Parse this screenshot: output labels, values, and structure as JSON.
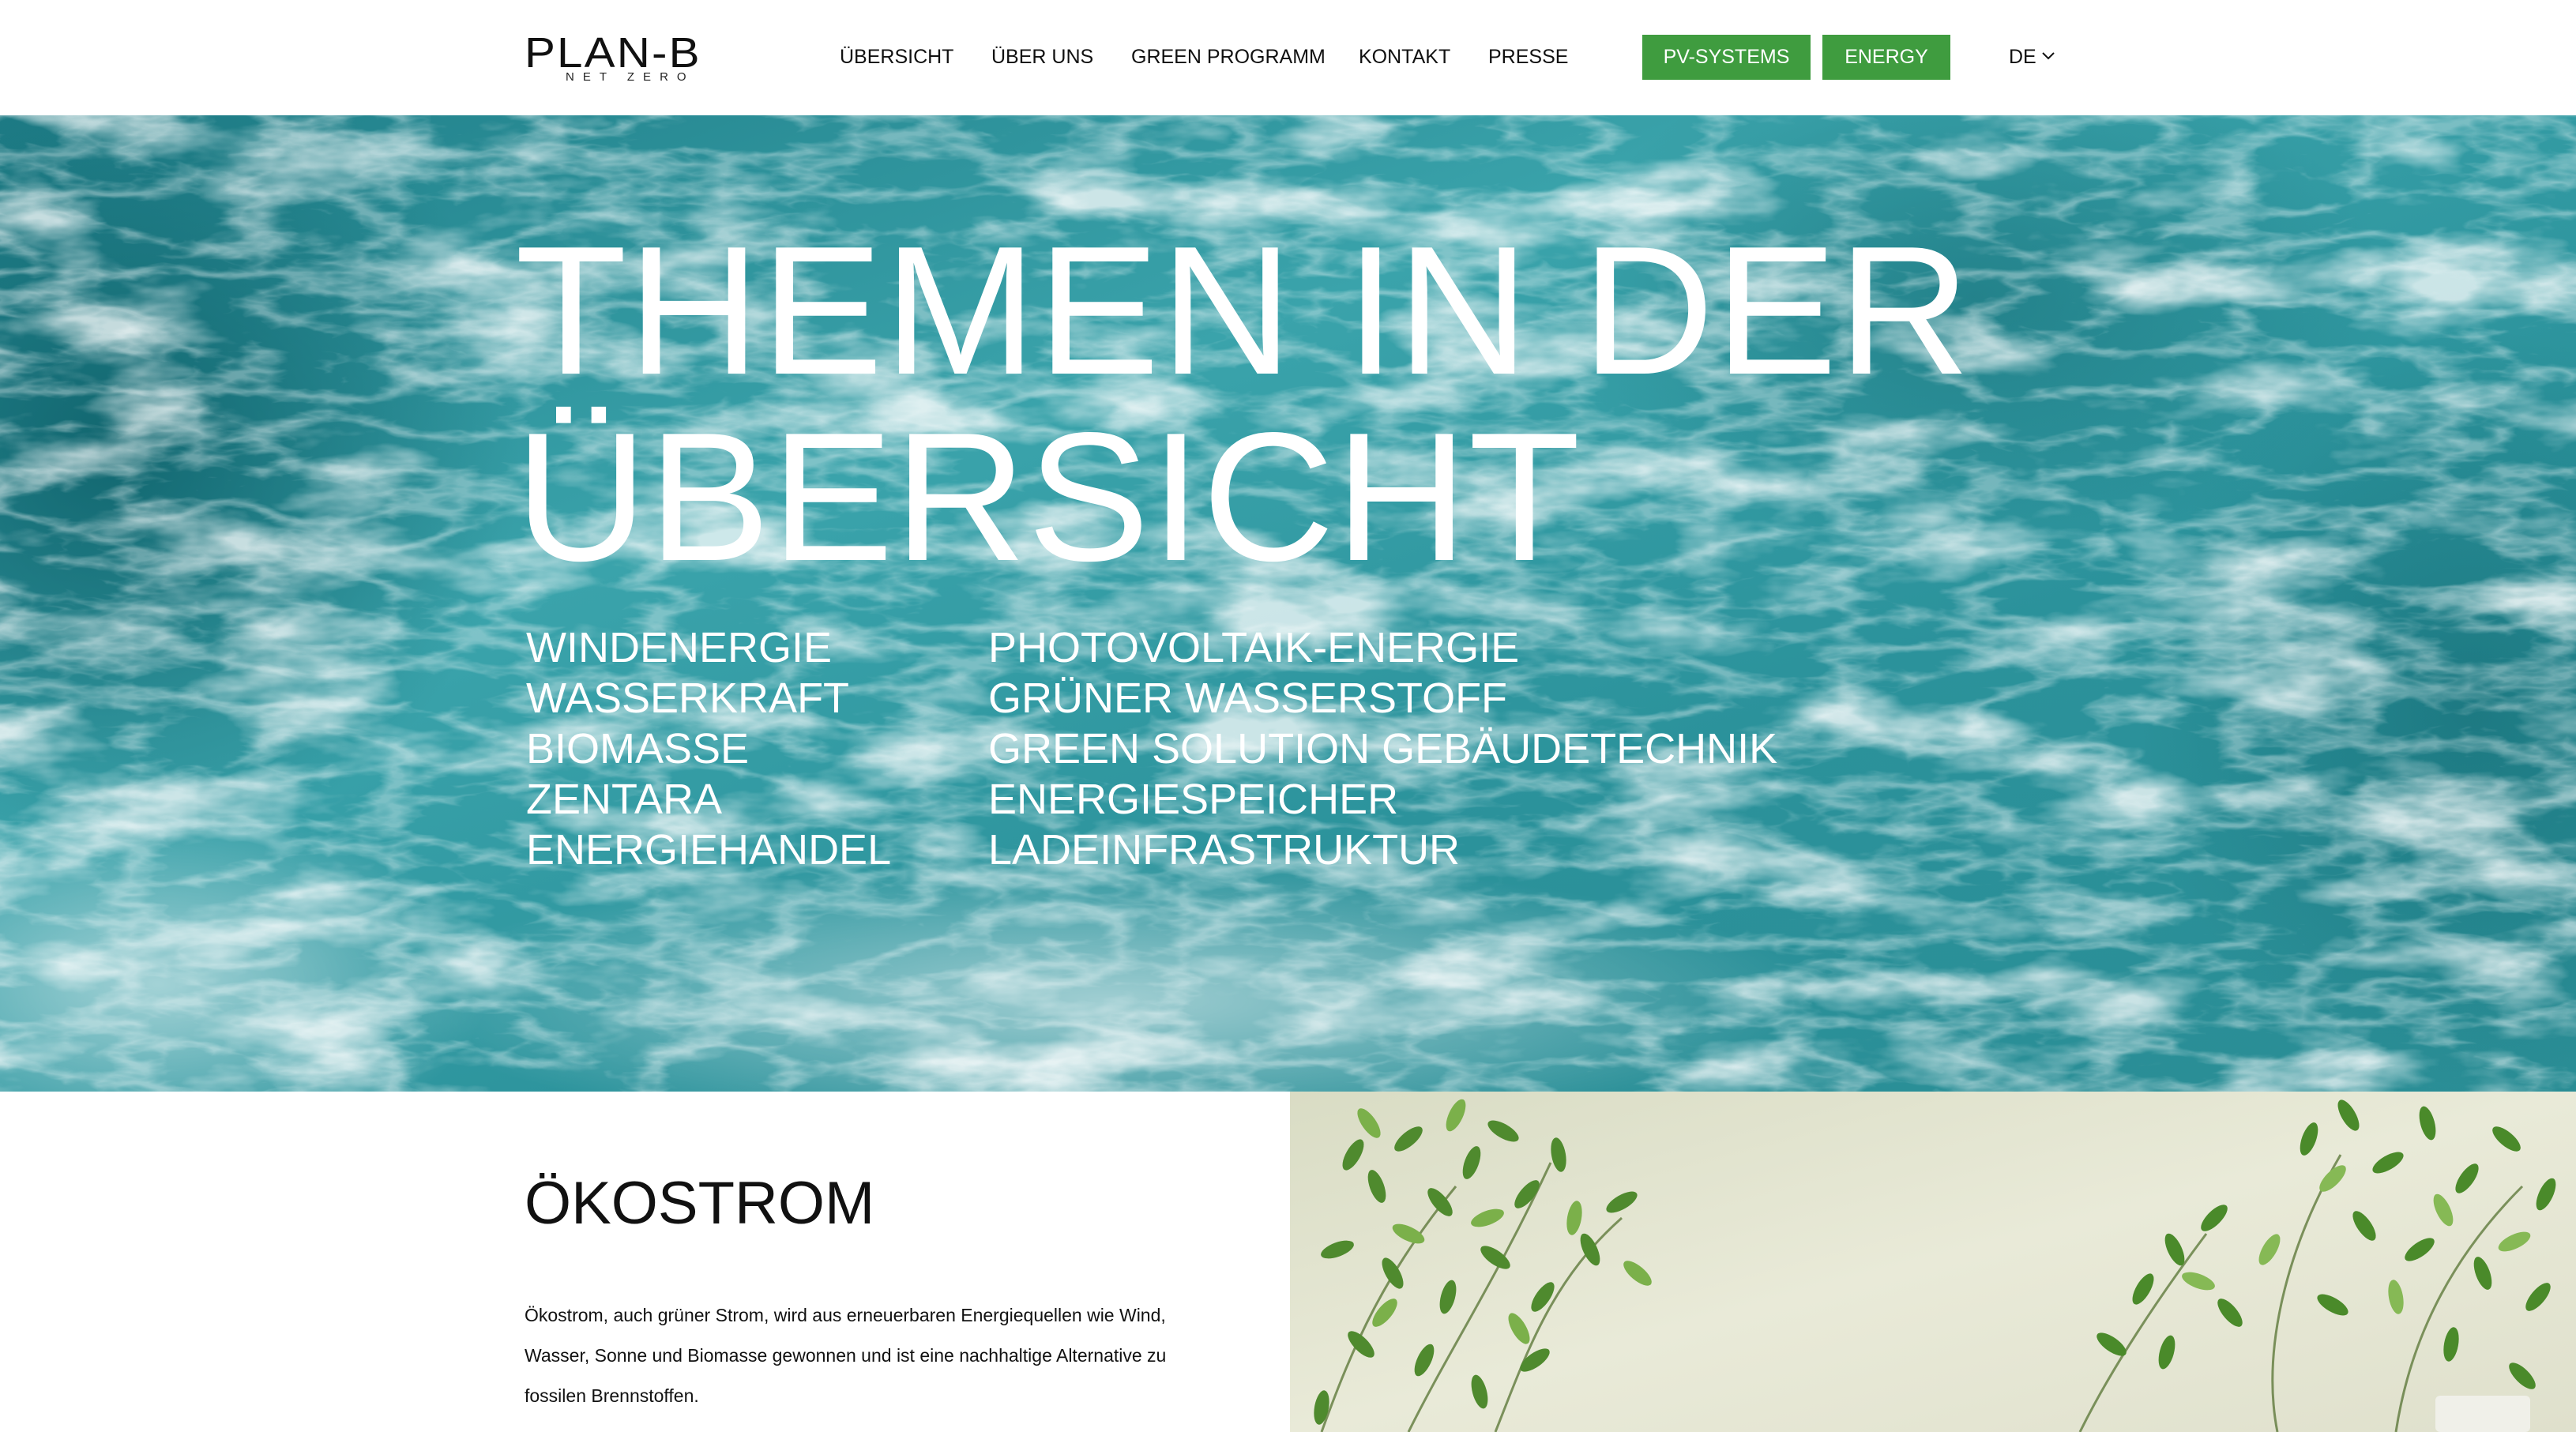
{
  "header": {
    "logo": {
      "main": "PLAN-B",
      "sub": "NET ZERO"
    },
    "nav": {
      "uebersicht": "ÜBERSICHT",
      "ueber_uns": "ÜBER UNS",
      "green_programm": "GREEN PROGRAMM",
      "kontakt": "KONTAKT",
      "presse": "PRESSE"
    },
    "buttons": {
      "pv_systems": "PV-SYSTEMS",
      "energy": "ENERGY"
    },
    "language": {
      "selected": "DE",
      "icon": "chevron-down-icon"
    }
  },
  "hero": {
    "title_line1": "THEMEN IN DER",
    "title_line2": "ÜBERSICHT",
    "topics_left": [
      "WINDENERGIE",
      "WASSERKRAFT",
      "BIOMASSE",
      "ZENTARA",
      "ENERGIEHANDEL"
    ],
    "topics_right": [
      "PHOTOVOLTAIK-ENERGIE",
      "GRÜNER WASSERSTOFF",
      "GREEN SOLUTION GEBÄUDETECHNIK",
      "ENERGIESPEICHER",
      "LADEINFRASTRUKTUR"
    ]
  },
  "section": {
    "title": "ÖKOSTROM",
    "text_line1": "Ökostrom, auch grüner Strom, wird aus erneuerbaren Energiequellen wie Wind,",
    "text_line2": "Wasser, Sonne und Biomasse gewonnen und ist eine nachhaltige Alternative zu",
    "text_line3": "fossilen Brennstoffen."
  },
  "colors": {
    "accent_green": "#3f9c3f",
    "water": "#2b8f98",
    "text": "#111111"
  }
}
